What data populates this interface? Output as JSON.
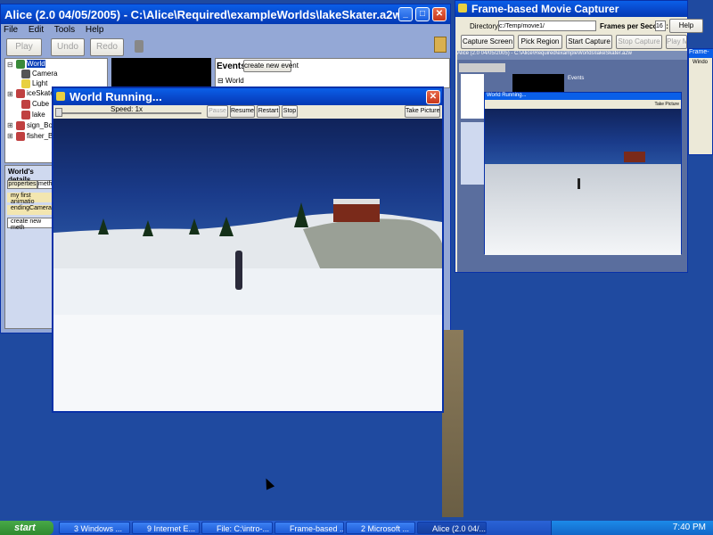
{
  "alice": {
    "title": "Alice (2.0 04/05/2005) - C:\\Alice\\Required\\exampleWorlds\\lakeSkater.a2w",
    "menu": [
      "File",
      "Edit",
      "Tools",
      "Help"
    ],
    "play": "Play",
    "undo": "Undo",
    "redo": "Redo",
    "tree": [
      "World",
      "Camera",
      "Light",
      "iceSkater",
      "Cube",
      "lake",
      "sign_Box",
      "fisher_Bo"
    ],
    "events_label": "Events",
    "create_event": "create new event",
    "world_event": "World",
    "details_title": "World's details",
    "tab_properties": "properties",
    "tab_methods": "meth",
    "methods": [
      "my first animatio",
      "endingCameraS"
    ],
    "create_method": "create new meth"
  },
  "running": {
    "title": "World Running...",
    "speed": "Speed: 1x",
    "pause": "Pause",
    "resume": "Resume",
    "restart": "Restart",
    "stop": "Stop",
    "take_picture": "Take Picture"
  },
  "capturer": {
    "title": "Frame-based Movie Capturer",
    "directory_label": "Directory:",
    "directory_value": "c:/Temp/movie1/",
    "fps_label": "Frames per Second:",
    "fps_value": "16",
    "help": "Help",
    "capture_screen": "Capture Screen",
    "pick_region": "Pick Region",
    "start_capture": "Start Capture",
    "stop_capture": "Stop Capture",
    "play_movie": "Play Movie",
    "inner_title": "Alice (2.0 04/05/2005) - C:\\Alice\\Required\\exampleWorlds\\lakeSkater.a2w",
    "inner_running": "World Running...",
    "inner_take_picture": "Take Picture",
    "inner_events": "Events"
  },
  "side_window": {
    "title": "Frame-",
    "label": "Windo"
  },
  "taskbar": {
    "start": "start",
    "items": [
      "3 Windows ...",
      "9 Internet E...",
      "File: C:\\intro-...",
      "Frame-based ...",
      "2 Microsoft ...",
      "Alice (2.0 04/..."
    ],
    "clock": "7:40 PM"
  },
  "colors": {
    "xp_blue": "#0a5fe8",
    "desktop": "#1f4aa0",
    "start_green": "#3c9a3c"
  }
}
